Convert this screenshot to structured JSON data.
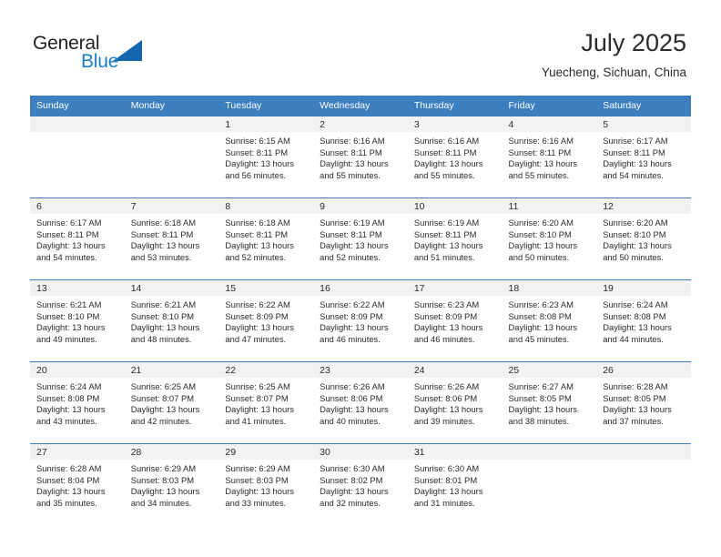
{
  "brand": {
    "name_part1": "General",
    "name_part2": "Blue",
    "logo_icon": "triangle-logo-icon",
    "accent_color": "#1567ad"
  },
  "header": {
    "title": "July 2025",
    "location": "Yuecheng, Sichuan, China"
  },
  "theme": {
    "header_blue": "#3c7fbf",
    "daynum_bg": "#f2f2f2",
    "text": "#2b2b2b"
  },
  "weekdays": [
    "Sunday",
    "Monday",
    "Tuesday",
    "Wednesday",
    "Thursday",
    "Friday",
    "Saturday"
  ],
  "calendar": {
    "weeks": [
      [
        {
          "day": "",
          "blank": true
        },
        {
          "day": "",
          "blank": true
        },
        {
          "day": "1",
          "sunrise": "Sunrise: 6:15 AM",
          "sunset": "Sunset: 8:11 PM",
          "daylight1": "Daylight: 13 hours",
          "daylight2": "and 56 minutes."
        },
        {
          "day": "2",
          "sunrise": "Sunrise: 6:16 AM",
          "sunset": "Sunset: 8:11 PM",
          "daylight1": "Daylight: 13 hours",
          "daylight2": "and 55 minutes."
        },
        {
          "day": "3",
          "sunrise": "Sunrise: 6:16 AM",
          "sunset": "Sunset: 8:11 PM",
          "daylight1": "Daylight: 13 hours",
          "daylight2": "and 55 minutes."
        },
        {
          "day": "4",
          "sunrise": "Sunrise: 6:16 AM",
          "sunset": "Sunset: 8:11 PM",
          "daylight1": "Daylight: 13 hours",
          "daylight2": "and 55 minutes."
        },
        {
          "day": "5",
          "sunrise": "Sunrise: 6:17 AM",
          "sunset": "Sunset: 8:11 PM",
          "daylight1": "Daylight: 13 hours",
          "daylight2": "and 54 minutes."
        }
      ],
      [
        {
          "day": "6",
          "sunrise": "Sunrise: 6:17 AM",
          "sunset": "Sunset: 8:11 PM",
          "daylight1": "Daylight: 13 hours",
          "daylight2": "and 54 minutes."
        },
        {
          "day": "7",
          "sunrise": "Sunrise: 6:18 AM",
          "sunset": "Sunset: 8:11 PM",
          "daylight1": "Daylight: 13 hours",
          "daylight2": "and 53 minutes."
        },
        {
          "day": "8",
          "sunrise": "Sunrise: 6:18 AM",
          "sunset": "Sunset: 8:11 PM",
          "daylight1": "Daylight: 13 hours",
          "daylight2": "and 52 minutes."
        },
        {
          "day": "9",
          "sunrise": "Sunrise: 6:19 AM",
          "sunset": "Sunset: 8:11 PM",
          "daylight1": "Daylight: 13 hours",
          "daylight2": "and 52 minutes."
        },
        {
          "day": "10",
          "sunrise": "Sunrise: 6:19 AM",
          "sunset": "Sunset: 8:11 PM",
          "daylight1": "Daylight: 13 hours",
          "daylight2": "and 51 minutes."
        },
        {
          "day": "11",
          "sunrise": "Sunrise: 6:20 AM",
          "sunset": "Sunset: 8:10 PM",
          "daylight1": "Daylight: 13 hours",
          "daylight2": "and 50 minutes."
        },
        {
          "day": "12",
          "sunrise": "Sunrise: 6:20 AM",
          "sunset": "Sunset: 8:10 PM",
          "daylight1": "Daylight: 13 hours",
          "daylight2": "and 50 minutes."
        }
      ],
      [
        {
          "day": "13",
          "sunrise": "Sunrise: 6:21 AM",
          "sunset": "Sunset: 8:10 PM",
          "daylight1": "Daylight: 13 hours",
          "daylight2": "and 49 minutes."
        },
        {
          "day": "14",
          "sunrise": "Sunrise: 6:21 AM",
          "sunset": "Sunset: 8:10 PM",
          "daylight1": "Daylight: 13 hours",
          "daylight2": "and 48 minutes."
        },
        {
          "day": "15",
          "sunrise": "Sunrise: 6:22 AM",
          "sunset": "Sunset: 8:09 PM",
          "daylight1": "Daylight: 13 hours",
          "daylight2": "and 47 minutes."
        },
        {
          "day": "16",
          "sunrise": "Sunrise: 6:22 AM",
          "sunset": "Sunset: 8:09 PM",
          "daylight1": "Daylight: 13 hours",
          "daylight2": "and 46 minutes."
        },
        {
          "day": "17",
          "sunrise": "Sunrise: 6:23 AM",
          "sunset": "Sunset: 8:09 PM",
          "daylight1": "Daylight: 13 hours",
          "daylight2": "and 46 minutes."
        },
        {
          "day": "18",
          "sunrise": "Sunrise: 6:23 AM",
          "sunset": "Sunset: 8:08 PM",
          "daylight1": "Daylight: 13 hours",
          "daylight2": "and 45 minutes."
        },
        {
          "day": "19",
          "sunrise": "Sunrise: 6:24 AM",
          "sunset": "Sunset: 8:08 PM",
          "daylight1": "Daylight: 13 hours",
          "daylight2": "and 44 minutes."
        }
      ],
      [
        {
          "day": "20",
          "sunrise": "Sunrise: 6:24 AM",
          "sunset": "Sunset: 8:08 PM",
          "daylight1": "Daylight: 13 hours",
          "daylight2": "and 43 minutes."
        },
        {
          "day": "21",
          "sunrise": "Sunrise: 6:25 AM",
          "sunset": "Sunset: 8:07 PM",
          "daylight1": "Daylight: 13 hours",
          "daylight2": "and 42 minutes."
        },
        {
          "day": "22",
          "sunrise": "Sunrise: 6:25 AM",
          "sunset": "Sunset: 8:07 PM",
          "daylight1": "Daylight: 13 hours",
          "daylight2": "and 41 minutes."
        },
        {
          "day": "23",
          "sunrise": "Sunrise: 6:26 AM",
          "sunset": "Sunset: 8:06 PM",
          "daylight1": "Daylight: 13 hours",
          "daylight2": "and 40 minutes."
        },
        {
          "day": "24",
          "sunrise": "Sunrise: 6:26 AM",
          "sunset": "Sunset: 8:06 PM",
          "daylight1": "Daylight: 13 hours",
          "daylight2": "and 39 minutes."
        },
        {
          "day": "25",
          "sunrise": "Sunrise: 6:27 AM",
          "sunset": "Sunset: 8:05 PM",
          "daylight1": "Daylight: 13 hours",
          "daylight2": "and 38 minutes."
        },
        {
          "day": "26",
          "sunrise": "Sunrise: 6:28 AM",
          "sunset": "Sunset: 8:05 PM",
          "daylight1": "Daylight: 13 hours",
          "daylight2": "and 37 minutes."
        }
      ],
      [
        {
          "day": "27",
          "sunrise": "Sunrise: 6:28 AM",
          "sunset": "Sunset: 8:04 PM",
          "daylight1": "Daylight: 13 hours",
          "daylight2": "and 35 minutes."
        },
        {
          "day": "28",
          "sunrise": "Sunrise: 6:29 AM",
          "sunset": "Sunset: 8:03 PM",
          "daylight1": "Daylight: 13 hours",
          "daylight2": "and 34 minutes."
        },
        {
          "day": "29",
          "sunrise": "Sunrise: 6:29 AM",
          "sunset": "Sunset: 8:03 PM",
          "daylight1": "Daylight: 13 hours",
          "daylight2": "and 33 minutes."
        },
        {
          "day": "30",
          "sunrise": "Sunrise: 6:30 AM",
          "sunset": "Sunset: 8:02 PM",
          "daylight1": "Daylight: 13 hours",
          "daylight2": "and 32 minutes."
        },
        {
          "day": "31",
          "sunrise": "Sunrise: 6:30 AM",
          "sunset": "Sunset: 8:01 PM",
          "daylight1": "Daylight: 13 hours",
          "daylight2": "and 31 minutes."
        },
        {
          "day": "",
          "blank": true
        },
        {
          "day": "",
          "blank": true
        }
      ]
    ]
  }
}
